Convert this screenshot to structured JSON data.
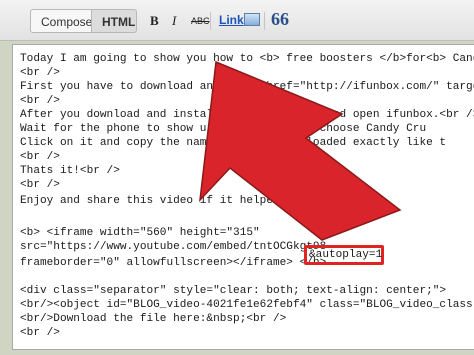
{
  "toolbar": {
    "tabs": [
      {
        "label": "Compose"
      },
      {
        "label": "HTML"
      }
    ],
    "bold_label": "B",
    "italic_label": "I",
    "strike_label": "ABC",
    "link_label": "Link",
    "quote_label": "66"
  },
  "editor": {
    "lines": [
      "Today I am going to show you how to <b> free boosters </b>for<b> Candy Cr",
      "<br />",
      "First you have to download and inst  href=\"http://ifunbox.com/\" target=",
      "<br />",
      "After you download and install it co      one and open ifunbox.<br />",
      "Wait for the phone to show u        pp Data, choose Candy Cru",
      "Click on it and copy the name. R       downloaded exactly like t",
      "<br />",
      "Thats it!<br />",
      "<br />",
      "Enjoy and share this video if it helped you!",
      "",
      "<b> <iframe width=\"560\" height=\"315\"",
      "src=\"https://www.youtube.com/embed/tntOCGkgt98",
      "frameborder=\"0\" allowfullscreen></iframe> </b>",
      "",
      "<div class=\"separator\" style=\"clear: both; text-align: center;\">",
      "<br/><object id=\"BLOG_video-4021fe1e62febf4\" class=\"BLOG_video_class\" conte",
      "<br/>Download the file here:&nbsp;<br />",
      "<br />"
    ],
    "highlight_text": "&autoplay=1"
  },
  "colors": {
    "arrow": "#d9242b",
    "highlight": "#e02424"
  }
}
